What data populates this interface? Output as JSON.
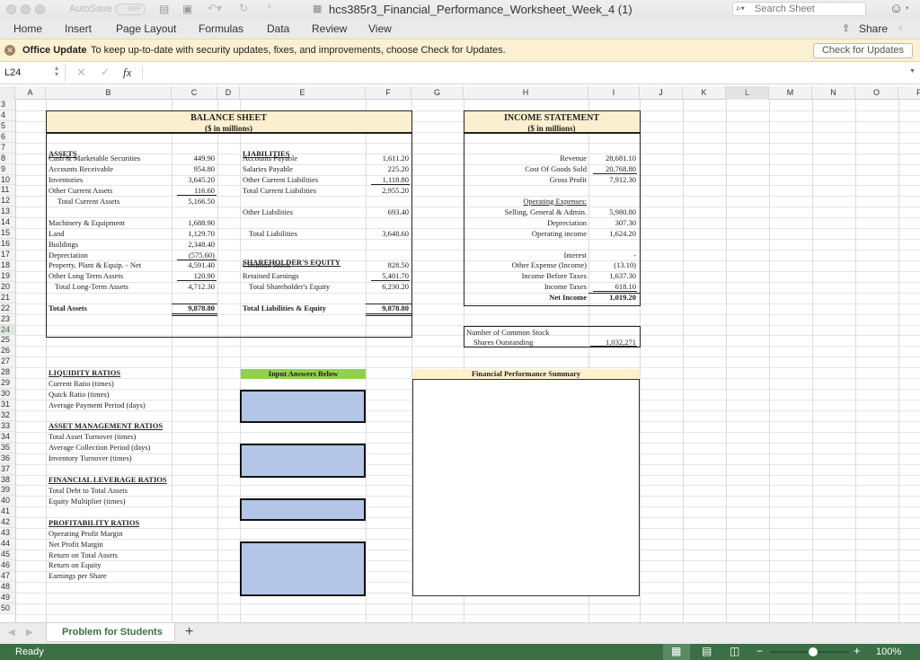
{
  "titlebar": {
    "autosave_label": "AutoSave",
    "autosave_state": "OFF",
    "doc_title": "hcs385r3_Financial_Performance_Worksheet_Week_4 (1)",
    "search_placeholder": "Search Sheet"
  },
  "ribbon": {
    "tabs": [
      "Home",
      "Insert",
      "Page Layout",
      "Formulas",
      "Data",
      "Review",
      "View"
    ],
    "share_label": "Share"
  },
  "message_bar": {
    "title": "Office Update",
    "text": "To keep up-to-date with security updates, fixes, and improvements, choose Check for Updates.",
    "button": "Check for Updates"
  },
  "formula_bar": {
    "cell_ref": "L24",
    "fx": "fx",
    "value": ""
  },
  "columns": [
    "A",
    "B",
    "C",
    "D",
    "E",
    "F",
    "G",
    "H",
    "I",
    "J",
    "K",
    "L",
    "M",
    "N",
    "O",
    "P"
  ],
  "rows": [
    "3",
    "4",
    "5",
    "6",
    "7",
    "8",
    "9",
    "10",
    "11",
    "12",
    "13",
    "14",
    "15",
    "16",
    "17",
    "18",
    "19",
    "20",
    "21",
    "22",
    "23",
    "24",
    "25",
    "26",
    "27",
    "28",
    "29",
    "30",
    "31",
    "32",
    "33",
    "34",
    "35",
    "36",
    "37",
    "38",
    "39",
    "40",
    "41",
    "42",
    "43",
    "44",
    "45",
    "46",
    "47",
    "48",
    "49",
    "50"
  ],
  "balance_sheet": {
    "title": "BALANCE SHEET",
    "subtitle": "($ in millions)",
    "assets_header": "ASSETS",
    "assets": [
      {
        "label": "Cash & Marketable Securities",
        "value": "449.90"
      },
      {
        "label": "Accounts Receivable",
        "value": "954.80"
      },
      {
        "label": "Inventories",
        "value": "3,645.20"
      },
      {
        "label": "Other Current Assets",
        "value": "116.60"
      },
      {
        "label": "Total Current Assets",
        "value": "5,166.50"
      },
      {
        "label": "Machinery & Equipment",
        "value": "1,688.90"
      },
      {
        "label": "Land",
        "value": "1,129.70"
      },
      {
        "label": "Buildings",
        "value": "2,348.40"
      },
      {
        "label": "Depreciation",
        "value": "(575.60)"
      },
      {
        "label": "Property, Plant & Equip. - Net",
        "value": "4,591.40"
      },
      {
        "label": "Other Long Term Assets",
        "value": "120.90"
      },
      {
        "label": "Total Long-Term Assets",
        "value": "4,712.30"
      },
      {
        "label": "Total Assets",
        "value": "9,878.80"
      }
    ],
    "liabilities_header": "LIABILITIES",
    "liabilities": [
      {
        "label": "Accounts Payable",
        "value": "1,611.20"
      },
      {
        "label": "Salaries Payable",
        "value": "225.20"
      },
      {
        "label": "Other Current Liabilities",
        "value": "1,118.80"
      },
      {
        "label": "Total Current Liabilities",
        "value": "2,955.20"
      },
      {
        "label": "Other Liabilities",
        "value": "693.40"
      },
      {
        "label": "Total Liabilities",
        "value": "3,648.60"
      }
    ],
    "equity_header": "SHAREHOLDER'S EQUITY",
    "equity": [
      {
        "label": "Common Stock",
        "value": "828.50"
      },
      {
        "label": "Retained Earnings",
        "value": "5,401.70"
      },
      {
        "label": "Total Shareholder's Equity",
        "value": "6,230.20"
      },
      {
        "label": "Total Liabilities & Equity",
        "value": "9,878.80"
      }
    ]
  },
  "income_statement": {
    "title": "INCOME STATEMENT",
    "subtitle": "($ in millions)",
    "lines": [
      {
        "label": "Revenue",
        "value": "28,681.10"
      },
      {
        "label": "Cost Of Goods Sold",
        "value": "20,768.80"
      },
      {
        "label": "Gross Profit",
        "value": "7,912.30"
      },
      {
        "label": "Operating Expenses:",
        "value": ""
      },
      {
        "label": "Selling, General & Admin.",
        "value": "5,980.80"
      },
      {
        "label": "Depreciation",
        "value": "307.30"
      },
      {
        "label": "Operating income",
        "value": "1,624.20"
      },
      {
        "label": "Interest",
        "value": "-"
      },
      {
        "label": "Other Expense (Income)",
        "value": "(13.10)"
      },
      {
        "label": "Income Before Taxes",
        "value": "1,637.30"
      },
      {
        "label": "Income Taxes",
        "value": "618.10"
      },
      {
        "label": "Net Income",
        "value": "1,019.20"
      }
    ],
    "shares_label_1": "Number of Common Stock",
    "shares_label_2": "Shares Outstanding",
    "shares_value": "1,032,271"
  },
  "ratios": {
    "input_header": "Input Answers Below",
    "summary_header": "Financial Performance Summary",
    "groups": [
      {
        "title": "LIQUIDITY RATIOS",
        "items": [
          "Current Ratio (times)",
          "Quick Ratio (times)",
          "Average Payment Period (days)"
        ]
      },
      {
        "title": "ASSET MANAGEMENT RATIOS",
        "items": [
          "Total Asset Turnover (times)",
          "Average Collection Period (days)",
          "Inventory Turnover (times)"
        ]
      },
      {
        "title": "FINANCIAL LEVERAGE RATIOS",
        "items": [
          "Total Debt to Total Assets",
          "Equity Multiplier (times)"
        ]
      },
      {
        "title": "PROFITABILITY RATIOS",
        "items": [
          "Operating Profit Margin",
          "Net Profit Margin",
          "Return on Total Assets",
          "Return on Equity",
          "Earnings per Share"
        ]
      }
    ]
  },
  "sheet_tabs": {
    "active": "Problem for Students",
    "add": "+"
  },
  "status": {
    "text": "Ready",
    "zoom": "100%",
    "zoom_fraction": 0.5
  },
  "colors": {
    "header_fill": "#fcefcf",
    "input_fill": "#b4c6e7",
    "green_header": "#92d050",
    "summary_fill": "#fff2cc",
    "status_bar": "#3b7046"
  }
}
